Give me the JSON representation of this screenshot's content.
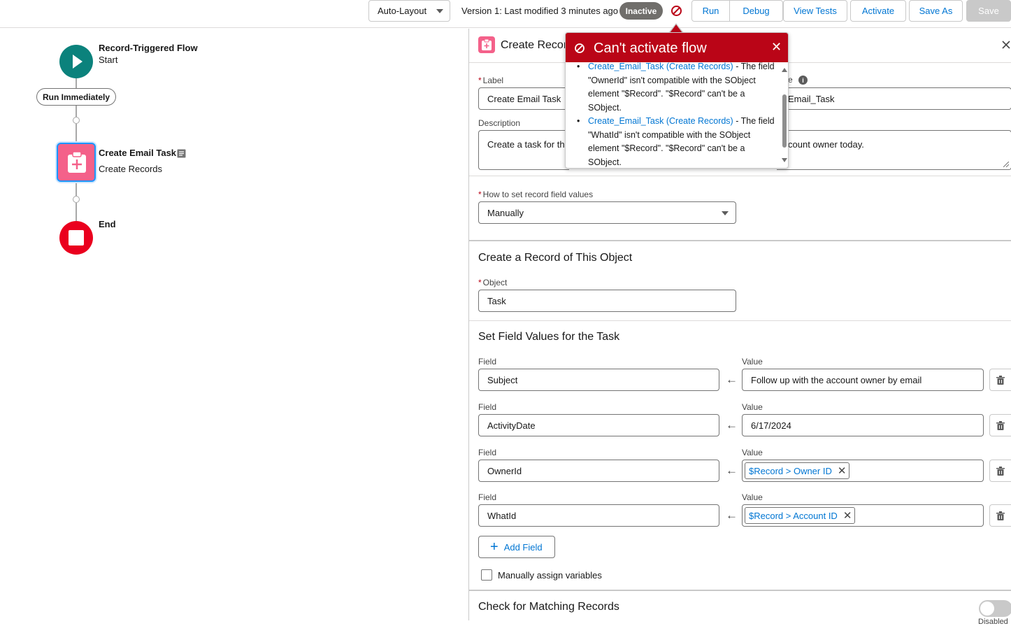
{
  "toolbar": {
    "layout_select": "Auto-Layout",
    "version_text": "Version 1: Last modified 3 minutes ago",
    "status": "Inactive",
    "buttons": {
      "run": "Run",
      "debug": "Debug",
      "view_tests": "View Tests",
      "activate": "Activate",
      "save_as": "Save As",
      "save": "Save"
    }
  },
  "canvas": {
    "start": {
      "title": "Record-Triggered Flow",
      "subtitle": "Start"
    },
    "run_path": "Run Immediately",
    "element": {
      "title": "Create Email Task",
      "subtitle": "Create Records"
    },
    "end": {
      "title": "End"
    }
  },
  "panel": {
    "title": "Create Recor",
    "label": {
      "label": "Label",
      "value": "Create Email Task"
    },
    "api_name": {
      "label_partial": "e",
      "value": "Email_Task"
    },
    "description": {
      "label": "Description",
      "value_left": "Create a task for th",
      "value_right": "count owner today."
    },
    "how_to_set": {
      "label": "How to set record field values",
      "value": "Manually"
    },
    "object_section": {
      "title": "Create a Record of This Object",
      "object_label": "Object",
      "object_value": "Task"
    },
    "fields_section": {
      "title": "Set Field Values for the Task",
      "field_label": "Field",
      "value_label": "Value",
      "rows": [
        {
          "field": "Subject",
          "value": "Follow up with the account owner by email"
        },
        {
          "field": "ActivityDate",
          "value": "6/17/2024"
        },
        {
          "field": "OwnerId",
          "token": "$Record > Owner ID"
        },
        {
          "field": "WhatId",
          "token": "$Record > Account ID"
        }
      ],
      "add_field": "Add Field"
    },
    "manual_assign": "Manually assign variables",
    "matching": {
      "title": "Check for Matching Records",
      "toggle_state": "off",
      "toggle_label": "Disabled"
    }
  },
  "error_popover": {
    "title": "Can't activate flow",
    "errors": [
      {
        "link": "Create_Email_Task (Create Records)",
        "lines": [
          " - The field",
          "\"OwnerId\" isn't compatible with the SObject",
          "element \"$Record\". \"$Record\" can't be a",
          "SObject."
        ]
      },
      {
        "link": "Create_Email_Task (Create Records)",
        "lines": [
          " - The field",
          "\"WhatId\" isn't compatible with the SObject",
          "element \"$Record\". \"$Record\" can't be a",
          "SObject."
        ]
      }
    ]
  },
  "colors": {
    "brand_blue": "#0176d3",
    "error_red": "#ba0517",
    "start_teal": "#0b827c",
    "task_pink": "#f4618a",
    "end_red": "#ea001e"
  },
  "icons": [
    "chevron-down-icon",
    "error-icon",
    "play-icon",
    "clipboard-add-icon",
    "notes-icon",
    "stop-icon",
    "close-icon",
    "info-icon",
    "left-arrow-icon",
    "trash-icon",
    "plus-icon"
  ]
}
